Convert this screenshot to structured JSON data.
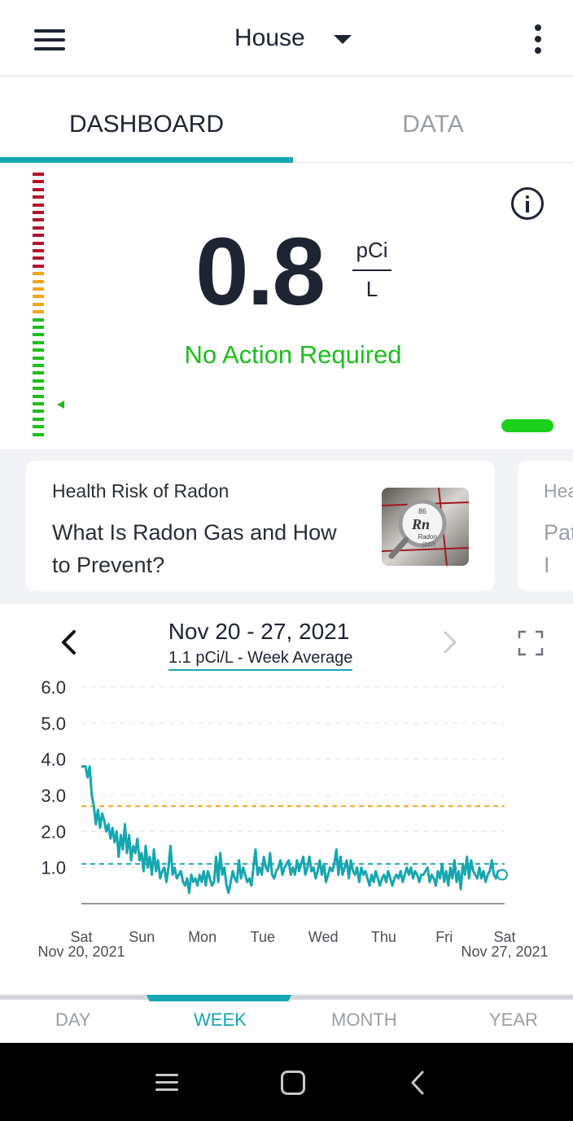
{
  "app_bar": {
    "location": "House",
    "menu_icon": "hamburger-menu-icon",
    "caret_icon": "caret-down-icon",
    "overflow_icon": "more-vertical-icon"
  },
  "tabs": [
    {
      "label": "DASHBOARD",
      "active": true
    },
    {
      "label": "DATA",
      "active": false
    }
  ],
  "reading": {
    "value": "0.8",
    "unit_top": "pCi",
    "unit_bottom": "L",
    "status": "No Action Required",
    "status_color": "#1bbf1b"
  },
  "gauge_colors": {
    "red": "#b3132b",
    "orange": "#f2a51f",
    "green": "#1bbf1b"
  },
  "cards": [
    {
      "kicker": "Health Risk of Radon",
      "title": "What Is Radon Gas and How to Prevent?",
      "image_labels": {
        "number": "86",
        "symbol": "Rn",
        "name": "Radon",
        "mass": "(222)"
      }
    },
    {
      "kicker": "Hea",
      "title": "Pat of I"
    }
  ],
  "chart_panel": {
    "date_range": "Nov 20 - 27, 2021",
    "average_label": "1.1 pCi/L - Week Average"
  },
  "chart_data": {
    "type": "line",
    "ylim": [
      0,
      6.0
    ],
    "yticks": [
      "6.0",
      "5.0",
      "4.0",
      "3.0",
      "2.0",
      "1.0"
    ],
    "x_ticks": [
      {
        "day": "Sat",
        "date": "Nov 20, 2021"
      },
      {
        "day": "Sun",
        "date": ""
      },
      {
        "day": "Mon",
        "date": ""
      },
      {
        "day": "Tue",
        "date": ""
      },
      {
        "day": "Wed",
        "date": ""
      },
      {
        "day": "Thu",
        "date": ""
      },
      {
        "day": "Fri",
        "date": ""
      },
      {
        "day": "Sat",
        "date": "Nov 27, 2021"
      }
    ],
    "threshold_lines": [
      {
        "value": 2.7,
        "color": "#f2a51f"
      },
      {
        "value": 1.1,
        "color": "#15a6b1"
      }
    ],
    "series": [
      {
        "color": "#15a6b1",
        "values": [
          3.8,
          3.8,
          3.8,
          3.5,
          3.8,
          3.0,
          2.7,
          2.2,
          2.6,
          2.1,
          2.5,
          2.3,
          2.0,
          2.2,
          1.8,
          2.1,
          1.7,
          2.0,
          1.3,
          1.9,
          1.5,
          2.2,
          1.4,
          1.9,
          1.2,
          1.6,
          1.4,
          1.8,
          1.2,
          1.4,
          0.9,
          1.6,
          1.0,
          1.3,
          0.8,
          1.5,
          0.9,
          1.2,
          0.7,
          0.9,
          1.0,
          0.6,
          1.0,
          1.6,
          0.8,
          1.0,
          0.7,
          0.8,
          0.9,
          0.6,
          0.5,
          0.7,
          0.3,
          0.8,
          0.6,
          0.7,
          0.5,
          0.8,
          0.6,
          0.9,
          0.5,
          0.9,
          0.7,
          0.5,
          0.6,
          1.3,
          0.6,
          1.4,
          0.8,
          1.0,
          0.5,
          0.3,
          0.6,
          0.9,
          0.7,
          0.6,
          1.2,
          0.7,
          1.0,
          0.8,
          0.6,
          0.7,
          0.5,
          1.0,
          1.5,
          0.8,
          1.0,
          0.8,
          1.3,
          1.0,
          0.9,
          1.4,
          0.8,
          0.7,
          0.9,
          1.0,
          1.2,
          0.8,
          1.0,
          1.1,
          1.2,
          0.8,
          1.0,
          0.8,
          1.2,
          0.9,
          1.1,
          1.3,
          0.8,
          1.0,
          1.3,
          0.9,
          1.0,
          0.7,
          0.9,
          1.2,
          0.8,
          1.1,
          0.6,
          0.8,
          1.0,
          0.9,
          1.1,
          1.5,
          0.8,
          1.3,
          0.8,
          1.0,
          1.2,
          0.7,
          1.2,
          0.9,
          0.8,
          1.0,
          0.6,
          1.0,
          0.8,
          0.9,
          0.7,
          0.5,
          0.8,
          0.6,
          0.9,
          0.7,
          0.5,
          0.7,
          0.8,
          0.6,
          0.9,
          0.7,
          0.5,
          0.7,
          0.8,
          0.7,
          0.9,
          0.6,
          0.8,
          1.0,
          0.8,
          1.0,
          0.7,
          0.9,
          0.8,
          0.6,
          0.8,
          0.8,
          0.9,
          1.0,
          0.6,
          0.8,
          0.7,
          0.5,
          0.9,
          0.7,
          1.1,
          0.6,
          0.9,
          0.5,
          1.0,
          0.7,
          1.2,
          0.6,
          0.9,
          0.4,
          1.1,
          0.8,
          1.3,
          0.7,
          1.2,
          0.9,
          0.8,
          0.7,
          1.0,
          0.7,
          0.9,
          0.6,
          0.8,
          0.9,
          1.2,
          0.8,
          0.7,
          0.9,
          0.7,
          0.7
        ]
      }
    ],
    "end_marker_value": 0.8
  },
  "range_tabs": [
    {
      "label": "DAY",
      "active": false
    },
    {
      "label": "WEEK",
      "active": true
    },
    {
      "label": "MONTH",
      "active": false
    },
    {
      "label": "YEAR",
      "active": false
    }
  ],
  "system_nav": {
    "recent_icon": "recent-apps-icon",
    "home_icon": "home-icon",
    "back_icon": "back-icon"
  }
}
